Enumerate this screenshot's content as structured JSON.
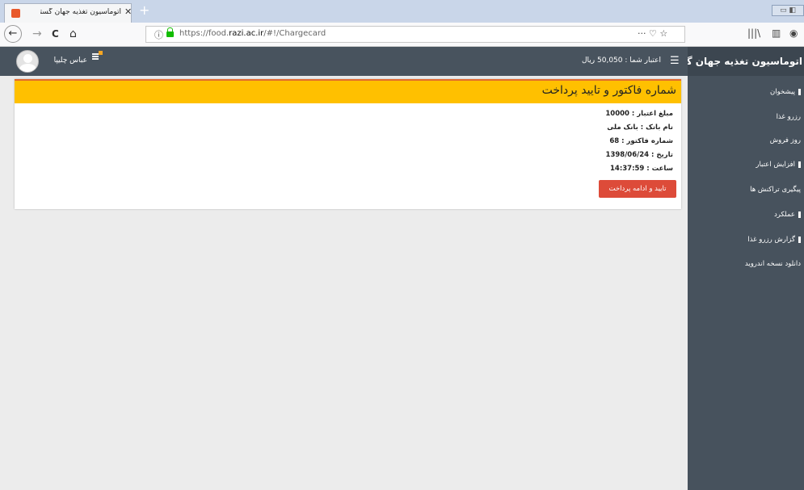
{
  "browser": {
    "tab_title": "اتوماسیون تغذیه جهان گستر",
    "tab_close": "✕",
    "new_tab": "+",
    "window_controls": "▭ ◧",
    "back": "←",
    "forward": "→",
    "reload": "C",
    "home": "⌂",
    "url_prefix": "https://food.",
    "url_domain": "razi.ac.ir",
    "url_suffix": "/#!/Chargecard",
    "page_actions": "···  ♡  ☆",
    "library": "|||\\",
    "sidebar_toggle": "▥",
    "menu": "◉"
  },
  "header": {
    "brand": "اتوماسیون تغذیه جهان گستر",
    "menu_icon": "☰",
    "credit_label": "اعتبار شما : 50,050 ریال",
    "username": "عباس چلیپا"
  },
  "sidebar": {
    "items": [
      {
        "label": "پیشخوان"
      },
      {
        "label": "رزرو غذا"
      },
      {
        "label": "روز فروش"
      },
      {
        "label": "افزایش اعتبار"
      },
      {
        "label": "پیگیری تراکنش ها"
      },
      {
        "label": "عملکرد"
      },
      {
        "label": "گزارش رزرو غذا"
      },
      {
        "label": "دانلود نسخه اندروید"
      }
    ]
  },
  "invoice": {
    "title": "شماره فاکتور و تایید پرداخت",
    "amount": "مبلغ اعتبار : 10000",
    "bank": "نام بانک : بانک ملی",
    "invoice_no": "شماره فاکتور : 68",
    "date": "تاریخ : 1398/06/24",
    "time": "ساعت : 14:37:59",
    "confirm_button": "تایید و ادامه پرداخت"
  }
}
